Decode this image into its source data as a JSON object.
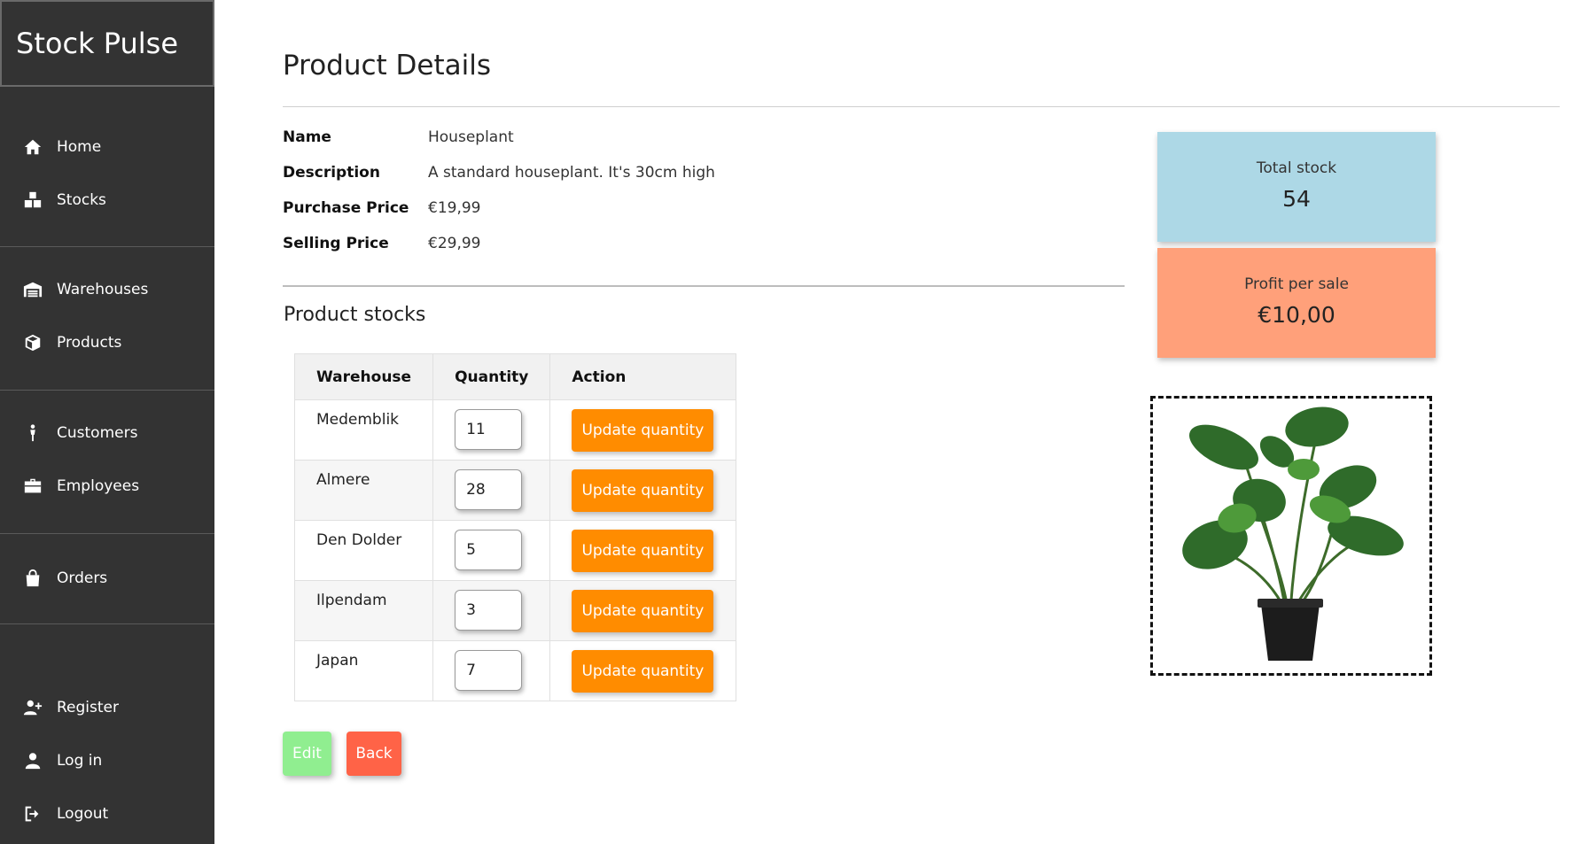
{
  "app": {
    "title": "Stock Pulse"
  },
  "sidebar": {
    "items": [
      {
        "label": "Home",
        "icon": "home-icon"
      },
      {
        "label": "Stocks",
        "icon": "boxes-icon"
      },
      {
        "label": "Warehouses",
        "icon": "warehouse-icon"
      },
      {
        "label": "Products",
        "icon": "box-icon"
      },
      {
        "label": "Customers",
        "icon": "person-icon"
      },
      {
        "label": "Employees",
        "icon": "briefcase-icon"
      },
      {
        "label": "Orders",
        "icon": "shopping-bag-icon"
      },
      {
        "label": "Register",
        "icon": "user-plus-icon"
      },
      {
        "label": "Log in",
        "icon": "user-icon"
      },
      {
        "label": "Logout",
        "icon": "logout-icon"
      }
    ]
  },
  "main": {
    "title": "Product Details",
    "details": [
      {
        "key": "Name",
        "value": "Houseplant"
      },
      {
        "key": "Description",
        "value": "A standard houseplant. It's 30cm high"
      },
      {
        "key": "Purchase Price",
        "value": "€19,99"
      },
      {
        "key": "Selling Price",
        "value": "€29,99"
      }
    ],
    "stocks_title": "Product stocks",
    "table": {
      "headers": [
        "Warehouse",
        "Quantity",
        "Action"
      ],
      "rows": [
        {
          "warehouse": "Medemblik",
          "quantity": "11",
          "action": "Update quantity"
        },
        {
          "warehouse": "Almere",
          "quantity": "28",
          "action": "Update quantity"
        },
        {
          "warehouse": "Den Dolder",
          "quantity": "5",
          "action": "Update quantity"
        },
        {
          "warehouse": "Ilpendam",
          "quantity": "3",
          "action": "Update quantity"
        },
        {
          "warehouse": "Japan",
          "quantity": "7",
          "action": "Update quantity"
        }
      ]
    },
    "buttons": {
      "edit": "Edit",
      "back": "Back"
    }
  },
  "stats": {
    "total_stock": {
      "label": "Total stock",
      "value": "54"
    },
    "profit": {
      "label": "Profit per sale",
      "value": "€10,00"
    }
  },
  "image": {
    "icon": "houseplant-image"
  },
  "colors": {
    "sidebar": "#333333",
    "update_button": "#ff8c00",
    "edit_button": "#90ee90",
    "back_button": "#ff6347",
    "total_card": "#add8e6",
    "profit_card": "#ffa07a"
  }
}
